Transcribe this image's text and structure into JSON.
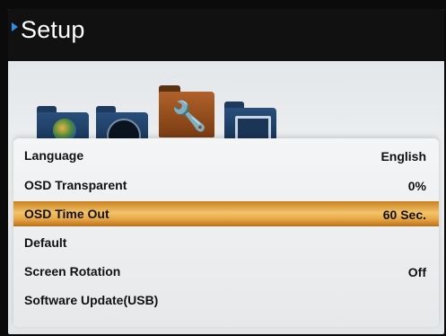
{
  "header": {
    "title": "Setup"
  },
  "icons": [
    {
      "name": "language-folder-icon"
    },
    {
      "name": "display-folder-icon"
    },
    {
      "name": "setup-folder-icon",
      "selected": true
    },
    {
      "name": "screen-folder-icon"
    }
  ],
  "menu": {
    "items": [
      {
        "label": "Language",
        "value": "English"
      },
      {
        "label": "OSD Transparent",
        "value": "0%"
      },
      {
        "label": "OSD Time Out",
        "value": "60 Sec.",
        "selected": true
      },
      {
        "label": "Default",
        "value": ""
      },
      {
        "label": "Screen Rotation",
        "value": "Off"
      },
      {
        "label": "Software Update(USB)",
        "value": ""
      }
    ]
  },
  "colors": {
    "accent": "#2f8fe6",
    "highlight": "#eaa848",
    "header_bg": "#111111"
  }
}
